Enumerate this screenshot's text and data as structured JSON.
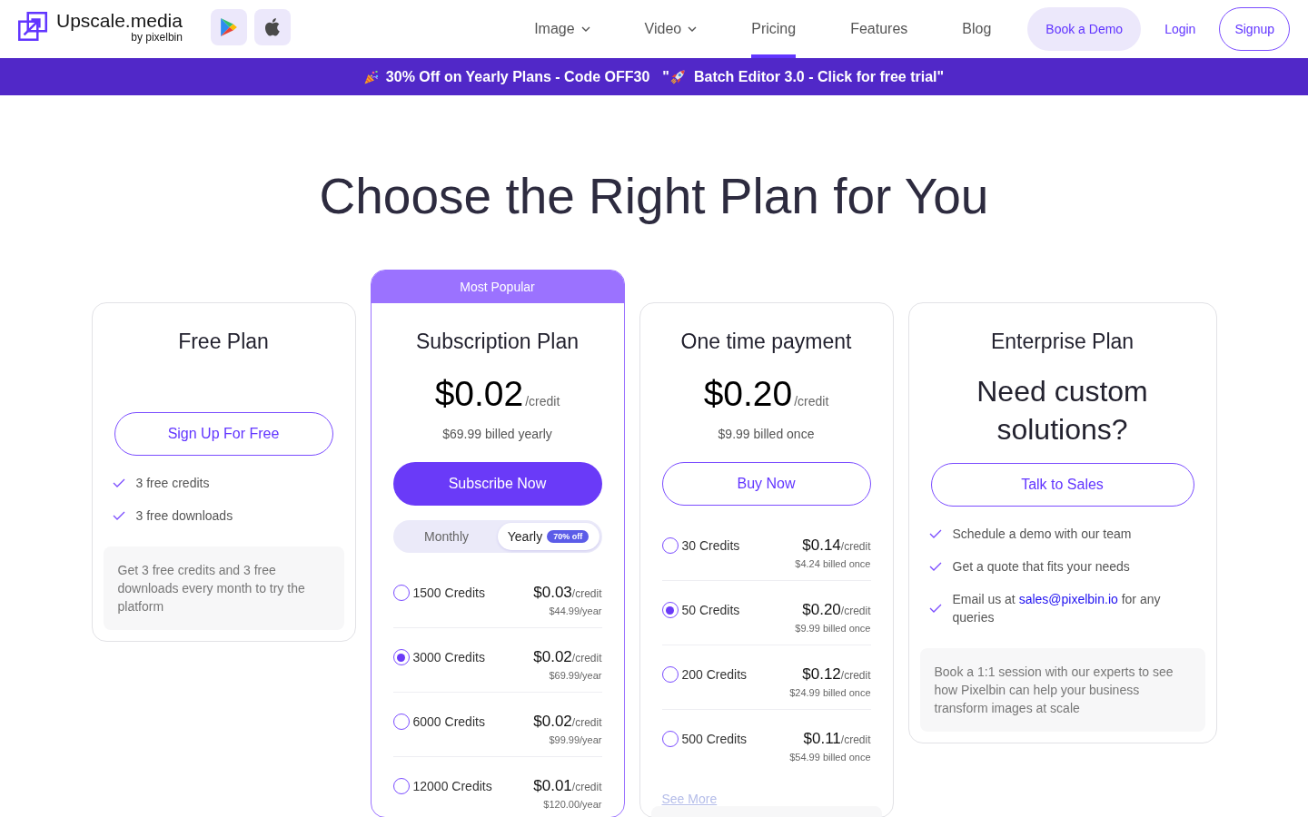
{
  "header": {
    "logo": {
      "name": "Upscale.media",
      "byline": "by pixelbin"
    },
    "nav": [
      {
        "label": "Image",
        "dropdown": true,
        "selected": false
      },
      {
        "label": "Video",
        "dropdown": true,
        "selected": false
      },
      {
        "label": "Pricing",
        "dropdown": false,
        "selected": true
      },
      {
        "label": "Features",
        "dropdown": false,
        "selected": false
      },
      {
        "label": "Blog",
        "dropdown": false,
        "selected": false
      }
    ],
    "actions": [
      {
        "label": "Book a Demo",
        "kind": "soft"
      },
      {
        "label": "Login",
        "kind": "link"
      },
      {
        "label": "Signup",
        "kind": "outline"
      }
    ]
  },
  "banner": {
    "offer": "30% Off on Yearly Plans - Code OFF30",
    "promo_prefix": "\"",
    "promo": "Batch Editor 3.0 - Click for free trial\""
  },
  "heading": "Choose the Right Plan for You",
  "plans": [
    {
      "featured": false,
      "title": "Free Plan",
      "button": {
        "label": "Sign Up For Free",
        "kind": "outline"
      },
      "features": [
        {
          "kind": "text",
          "text": "3 free credits"
        },
        {
          "kind": "text",
          "text": "3 free downloads"
        }
      ],
      "note": "Get 3 free credits and 3 free downloads every month to try the platform"
    },
    {
      "featured": true,
      "badge": "Most Popular",
      "title": "Subscription Plan",
      "price": {
        "amount": "$0.02",
        "unit": "/credit",
        "billing": "$69.99 billed yearly"
      },
      "button": {
        "label": "Subscribe Now",
        "kind": "filled"
      },
      "billing_toggle": [
        {
          "label": "Monthly",
          "selected": false
        },
        {
          "label": "Yearly",
          "selected": true,
          "badge": "70% off"
        }
      ],
      "options": [
        {
          "credits": "1500 Credits",
          "price": "$0.03",
          "unit": "/credit",
          "billing": "$44.99/year",
          "selected": false
        },
        {
          "credits": "3000 Credits",
          "price": "$0.02",
          "unit": "/credit",
          "billing": "$69.99/year",
          "selected": true
        },
        {
          "credits": "6000 Credits",
          "price": "$0.02",
          "unit": "/credit",
          "billing": "$99.99/year",
          "selected": false
        },
        {
          "credits": "12000 Credits",
          "price": "$0.01",
          "unit": "/credit",
          "billing": "$120.00/year",
          "selected": false
        }
      ]
    },
    {
      "featured": false,
      "title": "One time payment",
      "price": {
        "amount": "$0.20",
        "unit": "/credit",
        "billing": "$9.99 billed once"
      },
      "button": {
        "label": "Buy Now",
        "kind": "outline"
      },
      "options": [
        {
          "credits": "30 Credits",
          "price": "$0.14",
          "unit": "/credit",
          "billing": "$4.24 billed once",
          "selected": false
        },
        {
          "credits": "50 Credits",
          "price": "$0.20",
          "unit": "/credit",
          "billing": "$9.99 billed once",
          "selected": true
        },
        {
          "credits": "200 Credits",
          "price": "$0.12",
          "unit": "/credit",
          "billing": "$24.99 billed once",
          "selected": false
        },
        {
          "credits": "500 Credits",
          "price": "$0.11",
          "unit": "/credit",
          "billing": "$54.99 billed once",
          "selected": false
        }
      ],
      "see_more": "See More",
      "note_panel": true
    },
    {
      "featured": false,
      "title": "Enterprise Plan",
      "headline": "Need custom solutions?",
      "button": {
        "label": "Talk to Sales",
        "kind": "outline"
      },
      "features": [
        {
          "kind": "text",
          "text": "Schedule a demo with our team"
        },
        {
          "kind": "text",
          "text": "Get a quote that fits your needs"
        },
        {
          "kind": "link",
          "text": "Email us at ",
          "link": "sales@pixelbin.io",
          "after": " for any queries"
        }
      ],
      "note": "Book a 1:1 session with our experts to see how Pixelbin can help your business transform images at scale"
    }
  ]
}
